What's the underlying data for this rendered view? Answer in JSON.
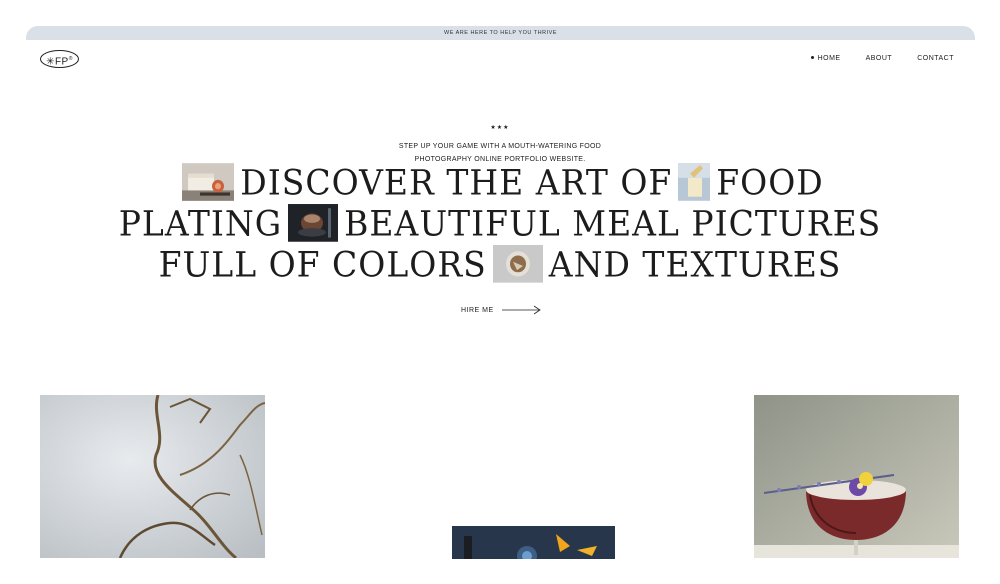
{
  "topbar": {
    "text": "WE ARE HERE TO HELP YOU THRIVE"
  },
  "logo": {
    "text": "FP",
    "mark": "®"
  },
  "nav": {
    "items": [
      "HOME",
      "ABOUT",
      "CONTACT"
    ]
  },
  "hero": {
    "stars": "★★★",
    "intro": "STEP UP YOUR GAME WITH A MOUTH-WATERING FOOD PHOTOGRAPHY ONLINE PORTFOLIO WEBSITE.",
    "line1a": "DISCOVER THE ART OF",
    "line1b": "FOOD",
    "line2a": "PLATING",
    "line2b": "BEAUTIFUL MEAL PICTURES",
    "line3a": "FULL OF COLORS",
    "line3b": "AND TEXTURES",
    "cta": "HIRE ME"
  },
  "colors": {
    "topbar_bg": "#d9e0e8",
    "text": "#1c1c1c",
    "background": "#ffffff"
  }
}
